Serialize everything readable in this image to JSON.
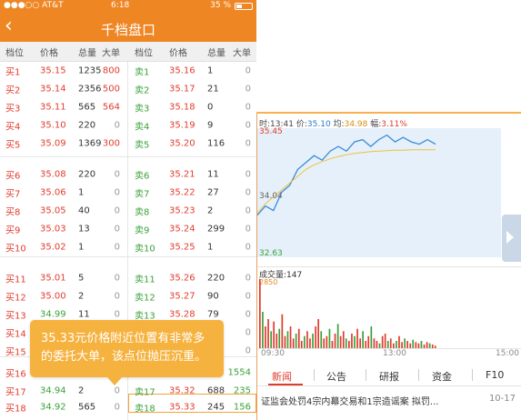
{
  "status": {
    "carrier": "●●●○○ AT&T",
    "time": "6:18",
    "battery": "35 %"
  },
  "nav": {
    "back": "‹",
    "title": "千档盘口"
  },
  "header": [
    "档位",
    "价格",
    "总量",
    "大单",
    "档位",
    "价格",
    "总量",
    "大单"
  ],
  "rows": [
    {
      "y": 0,
      "b": [
        "买1",
        "35.15",
        "1235",
        "800"
      ],
      "s": [
        "卖1",
        "35.16",
        "1",
        "0"
      ]
    },
    {
      "y": 20,
      "b": [
        "买2",
        "35.14",
        "2356",
        "500"
      ],
      "s": [
        "卖2",
        "35.17",
        "21",
        "0"
      ]
    },
    {
      "y": 40,
      "b": [
        "买3",
        "35.11",
        "565",
        "564"
      ],
      "s": [
        "卖3",
        "35.18",
        "0",
        "0"
      ]
    },
    {
      "y": 60,
      "b": [
        "买4",
        "35.10",
        "220",
        "0"
      ],
      "s": [
        "卖4",
        "35.19",
        "9",
        "0"
      ]
    },
    {
      "y": 80,
      "b": [
        "买5",
        "35.09",
        "1369",
        "300"
      ],
      "s": [
        "卖5",
        "35.20",
        "116",
        "0"
      ]
    },
    {
      "y": 110,
      "b": [
        "买6",
        "35.08",
        "220",
        "0"
      ],
      "s": [
        "卖6",
        "35.21",
        "11",
        "0"
      ]
    },
    {
      "y": 130,
      "b": [
        "买7",
        "35.06",
        "1",
        "0"
      ],
      "s": [
        "卖7",
        "35.22",
        "27",
        "0"
      ]
    },
    {
      "y": 150,
      "b": [
        "买8",
        "35.05",
        "40",
        "0"
      ],
      "s": [
        "卖8",
        "35.23",
        "2",
        "0"
      ]
    },
    {
      "y": 170,
      "b": [
        "买9",
        "35.03",
        "13",
        "0"
      ],
      "s": [
        "卖9",
        "35.24",
        "299",
        "0"
      ]
    },
    {
      "y": 190,
      "b": [
        "买10",
        "35.02",
        "1",
        "0"
      ],
      "s": [
        "卖10",
        "35.25",
        "1",
        "0"
      ]
    },
    {
      "y": 220,
      "b": [
        "买11",
        "35.01",
        "5",
        "0"
      ],
      "s": [
        "卖11",
        "35.26",
        "220",
        "0"
      ]
    },
    {
      "y": 240,
      "b": [
        "买12",
        "35.00",
        "2",
        "0"
      ],
      "s": [
        "卖12",
        "35.27",
        "90",
        "0"
      ]
    },
    {
      "y": 260,
      "b": [
        "买13",
        "34.99",
        "11",
        "0"
      ],
      "s": [
        "卖13",
        "35.28",
        "79",
        "0"
      ]
    },
    {
      "y": 280,
      "b": [
        "买14",
        "",
        "",
        ""
      ],
      "s": [
        "",
        "",
        "",
        "0"
      ]
    },
    {
      "y": 300,
      "b": [
        "买15",
        "",
        "",
        ""
      ],
      "s": [
        "",
        "",
        "",
        "0"
      ]
    },
    {
      "y": 328,
      "b": [
        "买16",
        "",
        "",
        ""
      ],
      "s": [
        "",
        "",
        "",
        "1554"
      ]
    },
    {
      "y": 348,
      "b": [
        "买17",
        "34.94",
        "2",
        "0"
      ],
      "s": [
        "卖17",
        "35.32",
        "688",
        "235"
      ]
    },
    {
      "y": 366,
      "b": [
        "买18",
        "34.92",
        "565",
        "0"
      ],
      "s": [
        "卖18",
        "35.33",
        "245",
        "156"
      ]
    }
  ],
  "tooltip": "35.33元价格附近位置有非常多的委托大单，该点位抛压沉重。",
  "chart": {
    "info_time": "时:13:41",
    "info_price_label": "价:",
    "info_price": "35.10",
    "info_avg_label": "均:",
    "info_avg": "34.98",
    "info_amp_label": "幅:",
    "info_amp": "3.11%",
    "price_max": "35.45",
    "price_mid": "34.04",
    "price_min": "32.63",
    "volume_label": "成交量:147",
    "volume_max": "2850",
    "time_start": "09:30",
    "time_mid": "13:00",
    "time_end": "15:00",
    "colors": {
      "price_line": "#3a8bd6",
      "avg_line": "#f0c040",
      "up": "#e03c2e",
      "down": "#3aa23a"
    }
  },
  "chart_data": {
    "type": "line",
    "series": [
      {
        "name": "价",
        "values": [
          33.55,
          33.75,
          33.65,
          34.05,
          34.2,
          34.55,
          34.7,
          34.85,
          34.75,
          34.95,
          35.05,
          34.95,
          35.15,
          35.2,
          35.05,
          35.2,
          35.3,
          35.15,
          35.25,
          35.15,
          35.1,
          35.2,
          35.1
        ]
      },
      {
        "name": "均",
        "values": [
          33.6,
          33.8,
          33.95,
          34.1,
          34.25,
          34.4,
          34.55,
          34.65,
          34.72,
          34.78,
          34.83,
          34.87,
          34.9,
          34.92,
          34.94,
          34.95,
          34.96,
          34.97,
          34.97,
          34.98,
          34.98,
          34.98,
          34.98
        ]
      }
    ],
    "volume": [
      2850,
      1500,
      900,
      1200,
      700,
      1100,
      600,
      800,
      1400,
      500,
      700,
      900,
      400,
      600,
      800,
      300,
      500,
      700,
      400,
      600,
      900,
      1200,
      700,
      400,
      500,
      800,
      300,
      600,
      1000,
      500,
      700,
      400,
      300,
      600,
      500,
      800,
      400,
      700,
      300,
      500,
      900,
      400,
      300,
      200,
      500,
      600,
      300,
      400,
      200,
      300,
      500,
      250,
      400,
      300,
      200,
      350,
      250,
      200,
      300,
      150,
      250,
      200,
      150,
      100
    ],
    "ylim": [
      32.63,
      35.45
    ],
    "title": ""
  },
  "tabs": [
    "新闻",
    "公告",
    "研报",
    "资金",
    "F10"
  ],
  "news": {
    "headline": "证监会处罚4宗内幕交易和1宗造谣案 拟罚...",
    "date": "10-17"
  }
}
